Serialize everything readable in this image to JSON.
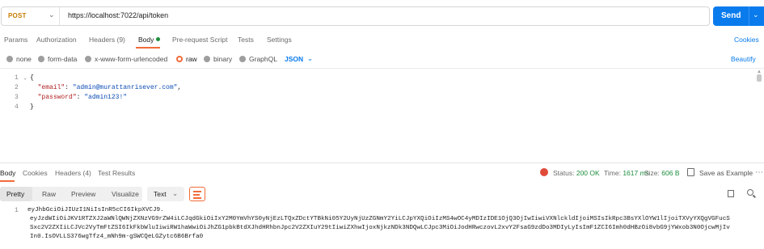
{
  "request": {
    "method": "POST",
    "url": "https://localhost:7022/api/token",
    "send_label": "Send"
  },
  "request_tabs": {
    "params": "Params",
    "authorization": "Authorization",
    "headers": "Headers (9)",
    "body": "Body",
    "pre_request": "Pre-request Script",
    "tests": "Tests",
    "settings": "Settings",
    "cookies": "Cookies"
  },
  "body_types": {
    "none": "none",
    "form_data": "form-data",
    "urlencoded": "x-www-form-urlencoded",
    "raw": "raw",
    "binary": "binary",
    "graphql": "GraphQL",
    "language": "JSON",
    "beautify": "Beautify"
  },
  "editor": {
    "line_numbers": [
      "1",
      "2",
      "3",
      "4"
    ],
    "open_brace": "{",
    "close_brace": "}",
    "email_key": "\"email\"",
    "email_value": "\"admin@murattanrisever.com\"",
    "password_key": "\"password\"",
    "password_value": "\"admin123!\"",
    "colon": ": ",
    "comma": ","
  },
  "response_tabs": {
    "body": "Body",
    "cookies": "Cookies",
    "headers": "Headers (4)",
    "test_results": "Test Results"
  },
  "response_status": {
    "status_label": "Status:",
    "status_value": "200 OK",
    "time_label": "Time:",
    "time_value": "1617 ms",
    "size_label": "Size:",
    "size_value": "606 B",
    "save_label": "Save as Example"
  },
  "response_view": {
    "pretty": "Pretty",
    "raw": "Raw",
    "preview": "Preview",
    "visualize": "Visualize",
    "format": "Text"
  },
  "response_body": {
    "line_number": "1",
    "lines": [
      "eyJhbGciOiJIUzI1NiIsInR5cCI6IkpXVCJ9.",
      "eyJzdWIiOiJKV1RTZXJ2aWNlQWNjZXNzVG9rZW4iLCJqdGkiOiIxY2M0YmVhYS0yNjEzLTQxZDctYTBkNi05Y2UyNjUzZGNmY2YiLCJpYXQiOiIzMS4wOC4yMDIzIDE1OjQ3OjIwIiwiVXNlckldIjoiMSIsIkRpc3BsYXlOYW1lIjoiTXVyYXQgVGFucS",
      "Sxc2V2ZXIiLCJVc2VyTmFtZSI6IkFkbWluIiwiRW1haWwiOiJhZG1pbkBtdXJhdHRhbnJpc2V2ZXIuY29tIiwiZXhwIjoxNjkzNDk3NDQwLCJpc3MiOiJodHRwczovL2xvY2FsaG9zdDo3MDIyLyIsImF1ZCI6Imh0dHBzOi8vbG9jYWxob3N0OjcwMjIv",
      "In0.IsOVLLS376wgTfz4_mNh9m-gSWCQeLGZytc6B6Brfa0"
    ]
  },
  "icons": {
    "method_chevron": "chevron-down-icon",
    "globe": "globe-icon",
    "save": "save-icon",
    "more": "more-icon",
    "copy": "copy-icon",
    "search": "search-icon",
    "wrap": "wrap-lines-icon"
  },
  "colors": {
    "accent": "#f26b3a",
    "primary": "#097bed",
    "success": "#1e8e3e",
    "method": "#c77d00"
  }
}
